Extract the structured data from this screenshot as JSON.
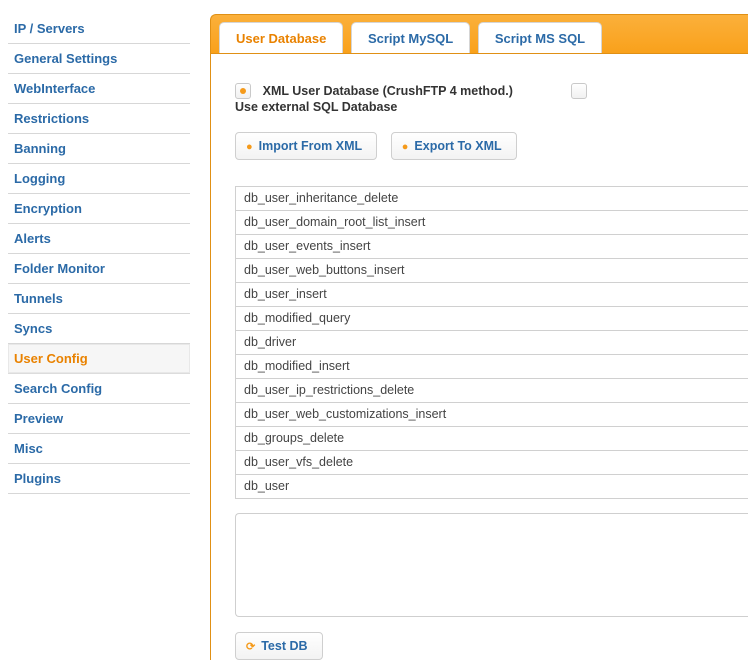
{
  "sidebar": {
    "items": [
      {
        "label": "IP / Servers"
      },
      {
        "label": "General Settings"
      },
      {
        "label": "WebInterface"
      },
      {
        "label": "Restrictions"
      },
      {
        "label": "Banning"
      },
      {
        "label": "Logging"
      },
      {
        "label": "Encryption"
      },
      {
        "label": "Alerts"
      },
      {
        "label": "Folder Monitor"
      },
      {
        "label": "Tunnels"
      },
      {
        "label": "Syncs"
      },
      {
        "label": "User Config"
      },
      {
        "label": "Search Config"
      },
      {
        "label": "Preview"
      },
      {
        "label": "Misc"
      },
      {
        "label": "Plugins"
      }
    ],
    "active_index": 11
  },
  "tabs": {
    "items": [
      {
        "label": "User Database"
      },
      {
        "label": "Script MySQL"
      },
      {
        "label": "Script MS SQL"
      }
    ],
    "active_index": 0
  },
  "db_source": {
    "xml_label": "XML User Database (CrushFTP 4 method.)",
    "sql_label": "Use external SQL Database",
    "selected": "xml"
  },
  "buttons": {
    "import_label": "Import From XML",
    "export_label": "Export To XML",
    "test_db_label": "Test DB"
  },
  "db_keys": [
    "db_user_inheritance_delete",
    "db_user_domain_root_list_insert",
    "db_user_events_insert",
    "db_user_web_buttons_insert",
    "db_user_insert",
    "db_modified_query",
    "db_driver",
    "db_modified_insert",
    "db_user_ip_restrictions_delete",
    "db_user_web_customizations_insert",
    "db_groups_delete",
    "db_user_vfs_delete",
    "db_user"
  ],
  "sql_text": ""
}
